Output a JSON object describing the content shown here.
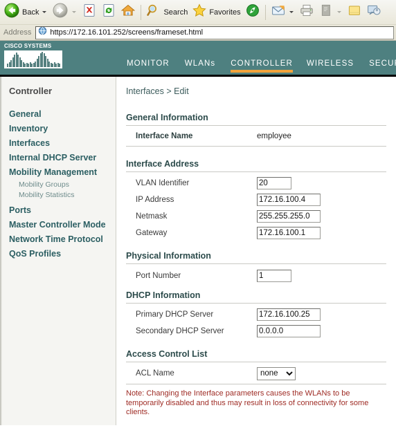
{
  "browser": {
    "back_label": "Back",
    "address_label": "Address",
    "url": "https://172.16.101.252/screens/frameset.html",
    "buttons": [
      {
        "name": "back",
        "label": "Back",
        "icon": "back-arrow-icon",
        "enabled": true
      },
      {
        "name": "forward",
        "label": "",
        "icon": "forward-arrow-icon",
        "enabled": false
      },
      {
        "name": "stop",
        "label": "",
        "icon": "stop-icon",
        "enabled": true
      },
      {
        "name": "refresh",
        "label": "",
        "icon": "refresh-icon",
        "enabled": true
      },
      {
        "name": "home",
        "label": "",
        "icon": "home-icon",
        "enabled": true
      },
      {
        "name": "search",
        "label": "Search",
        "icon": "search-icon",
        "enabled": true
      },
      {
        "name": "favorites",
        "label": "Favorites",
        "icon": "star-icon",
        "enabled": true
      },
      {
        "name": "media",
        "label": "",
        "icon": "media-icon",
        "enabled": true
      },
      {
        "name": "mail",
        "label": "",
        "icon": "mail-icon",
        "enabled": true
      },
      {
        "name": "print",
        "label": "",
        "icon": "printer-icon",
        "enabled": true
      },
      {
        "name": "edit",
        "label": "",
        "icon": "edit-page-icon",
        "enabled": false
      },
      {
        "name": "notes",
        "label": "",
        "icon": "notes-icon",
        "enabled": true
      },
      {
        "name": "discuss",
        "label": "",
        "icon": "discuss-icon",
        "enabled": true
      }
    ]
  },
  "header": {
    "brand": "CISCO SYSTEMS",
    "nav": [
      {
        "label": "MONITOR",
        "active": false
      },
      {
        "label": "WLANs",
        "active": false
      },
      {
        "label": "CONTROLLER",
        "active": true
      },
      {
        "label": "WIRELESS",
        "active": false
      },
      {
        "label": "SECURITY",
        "active": false
      }
    ],
    "accent_color": "#f2a33c",
    "band_color": "#4e8080"
  },
  "sidebar": {
    "title": "Controller",
    "items": [
      {
        "label": "General",
        "sub": false
      },
      {
        "label": "Inventory",
        "sub": false
      },
      {
        "label": "Interfaces",
        "sub": false
      },
      {
        "label": "Internal DHCP Server",
        "sub": false
      },
      {
        "label": "Mobility Management",
        "sub": false
      },
      {
        "label": "Mobility Groups",
        "sub": true
      },
      {
        "label": "Mobility Statistics",
        "sub": true
      },
      {
        "label": "Ports",
        "sub": false
      },
      {
        "label": "Master Controller Mode",
        "sub": false
      },
      {
        "label": "Network Time Protocol",
        "sub": false
      },
      {
        "label": "QoS Profiles",
        "sub": false
      }
    ]
  },
  "main": {
    "breadcrumb": "Interfaces > Edit",
    "general": {
      "heading": "General Information",
      "interface_name_label": "Interface Name",
      "interface_name_value": "employee"
    },
    "address": {
      "heading": "Interface Address",
      "vlan_label": "VLAN Identifier",
      "vlan_value": "20",
      "ip_label": "IP Address",
      "ip_value": "172.16.100.4",
      "netmask_label": "Netmask",
      "netmask_value": "255.255.255.0",
      "gateway_label": "Gateway",
      "gateway_value": "172.16.100.1"
    },
    "physical": {
      "heading": "Physical Information",
      "port_label": "Port Number",
      "port_value": "1"
    },
    "dhcp": {
      "heading": "DHCP Information",
      "primary_label": "Primary DHCP Server",
      "primary_value": "172.16.100.25",
      "secondary_label": "Secondary DHCP Server",
      "secondary_value": "0.0.0.0"
    },
    "acl": {
      "heading": "Access Control List",
      "name_label": "ACL Name",
      "selected": "none",
      "options": [
        "none"
      ]
    },
    "note": "Note: Changing the Interface parameters causes the WLANs to be temporarily disabled and thus may result in loss of connectivity for some clients.",
    "note_color": "#9e2b24"
  }
}
